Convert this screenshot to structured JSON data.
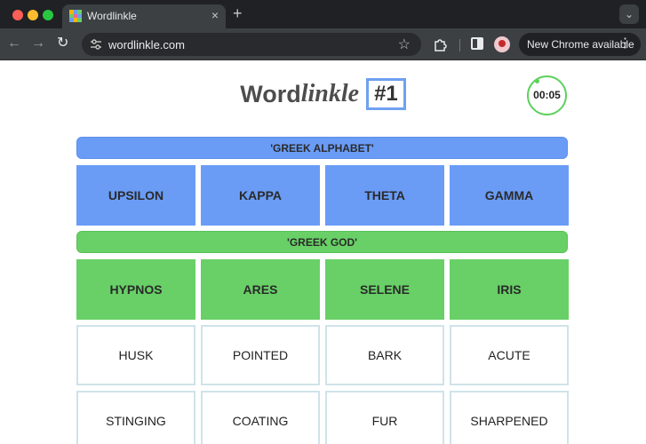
{
  "browser": {
    "tab_title": "Wordlinkle",
    "tab_close": "×",
    "new_tab": "+",
    "tab_menu": "⌄",
    "nav_back": "←",
    "nav_forward": "→",
    "nav_reload": "↻",
    "url": "wordlinkle.com",
    "bookmark_star": "☆",
    "update_label": "New Chrome available",
    "update_menu": "⋮"
  },
  "game": {
    "title_word": "Word",
    "title_italic": "linkle",
    "puzzle_number": "#1",
    "timer": "00:05",
    "groups": [
      {
        "category": "'GREEK ALPHABET'",
        "color": "#6a9cf6",
        "words": [
          "UPSILON",
          "KAPPA",
          "THETA",
          "GAMMA"
        ]
      },
      {
        "category": "'GREEK GOD'",
        "color": "#68d066",
        "words": [
          "HYPNOS",
          "ARES",
          "SELENE",
          "IRIS"
        ]
      }
    ],
    "remaining": [
      [
        "HUSK",
        "POINTED",
        "BARK",
        "ACUTE"
      ],
      [
        "STINGING",
        "COATING",
        "FUR",
        "SHARPENED"
      ]
    ]
  }
}
